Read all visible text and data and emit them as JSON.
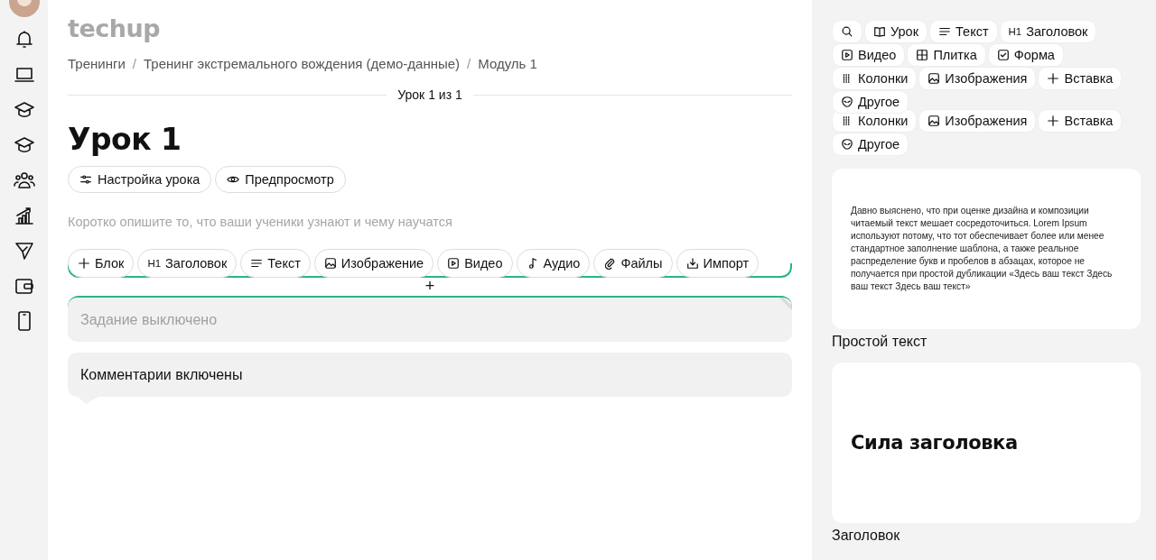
{
  "logo": "techup",
  "breadcrumbs": [
    {
      "label": "Тренинги"
    },
    {
      "separator": "/",
      "label": "Тренинг экстремального вождения (демо-данные)"
    },
    {
      "separator": "/",
      "label": "Модуль 1"
    }
  ],
  "lesson_counter": "Урок 1 из 1",
  "title": "Урок 1",
  "lesson_actions": [
    "Настройка урока",
    "Предпросмотр"
  ],
  "description": {
    "placeholder": "Коротко опишите то, что ваши ученики узнают и чему научатся"
  },
  "block_toolbar": [
    {
      "label": "Блок"
    },
    {
      "label": "Заголовок",
      "mark": "H1"
    },
    {
      "label": "Текст"
    },
    {
      "label": "Изображение"
    },
    {
      "label": "Видео"
    },
    {
      "label": "Аудио"
    },
    {
      "label": "Файлы"
    },
    {
      "label": "Импорт"
    }
  ],
  "insert_divider": {
    "symbol": "+"
  },
  "blocks": [
    {
      "kind": "task",
      "text": "Задание выключено",
      "enabled": false
    },
    {
      "kind": "comments",
      "text": "Комментарии включены",
      "enabled": true
    }
  ],
  "library": {
    "filters": [
      {
        "label": "Урок"
      },
      {
        "label": "Текст"
      },
      {
        "label": "Заголовок",
        "mark": "H1"
      },
      {
        "label": "Видео"
      },
      {
        "label": "Плитка"
      },
      {
        "label": "Форма"
      },
      {
        "label": "Колонки"
      },
      {
        "label": "Изображения"
      },
      {
        "label": "Вставка"
      },
      {
        "label": "Другое"
      }
    ],
    "filters_repeat": [
      {
        "label": "Колонки"
      },
      {
        "label": "Изображения"
      },
      {
        "label": "Вставка"
      },
      {
        "label": "Другое"
      }
    ],
    "templates": [
      {
        "kind": "text",
        "preview": "Давно выяснено, что при оценке дизайна и композиции читаемый текст мешает сосредоточиться. Lorem Ipsum используют потому, что тот обеспечивает более или менее стандартное заполнение шаблона, а также реальное распределение букв и пробелов в абзацах, которое не получается при простой дубликации «Здесь ваш текст Здесь ваш текст Здесь ваш текст»",
        "label": "Простой текст"
      },
      {
        "kind": "heading",
        "preview": "Сила заголовка",
        "label": "Заголовок"
      }
    ]
  }
}
